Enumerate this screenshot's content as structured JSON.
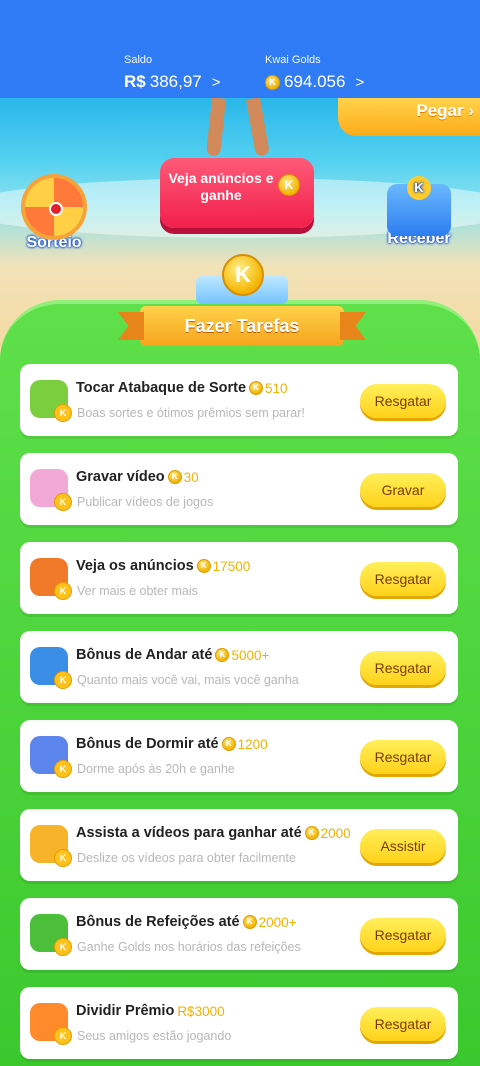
{
  "header": {
    "balance_label": "Saldo",
    "balance_currency": "R$",
    "balance_value": "386,97",
    "golds_label": "Kwai Golds",
    "golds_value": "694.056",
    "chevron": ">"
  },
  "scene": {
    "pegar_label": "Pegar",
    "ads_button_label": "Veja anúncios e ganhe",
    "sorteio_label": "Sorteio",
    "receber_label": "Receber"
  },
  "tasks_banner": "Fazer Tarefas",
  "tasks": [
    {
      "title": "Tocar Atabaque de Sorte",
      "reward": "510",
      "desc": "Boas sortes e ótimos prêmios sem parar!",
      "action": "Resgatar",
      "icon": "drum-icon",
      "icon_color": "#7bcf3f"
    },
    {
      "title": "Gravar vídeo",
      "reward": "30",
      "desc": "Publicar vídeos de jogos",
      "action": "Gravar",
      "icon": "video-record-icon",
      "icon_color": "#f3a9d6"
    },
    {
      "title": "Veja os anúncios",
      "reward": "17500",
      "desc": "Ver mais e obter mais",
      "action": "Resgatar",
      "icon": "tv-icon",
      "icon_color": "#f07a2a"
    },
    {
      "title": "Bônus de Andar até",
      "reward": "5000+",
      "desc": "Quanto mais você vai, mais você ganha",
      "action": "Resgatar",
      "icon": "walking-boy-icon",
      "icon_color": "#3a8ee6"
    },
    {
      "title": "Bônus de Dormir até",
      "reward": "1200",
      "desc": "Dorme após às 20h e ganhe",
      "action": "Resgatar",
      "icon": "sleep-moon-icon",
      "icon_color": "#5b84ec"
    },
    {
      "title": "Assista a vídeos para ganhar até",
      "reward": "2000",
      "desc": "Deslize os vídeos para obter facilmente",
      "action": "Assistir",
      "icon": "camera-icon",
      "icon_color": "#f7b32a"
    },
    {
      "title": "Bônus de Refeições até",
      "reward": "2000+",
      "desc": "Ganhe Golds nos horários das refeições",
      "action": "Resgatar",
      "icon": "calendar-meal-icon",
      "icon_color": "#4cbf3a"
    },
    {
      "title": "Dividir Prêmio",
      "reward": "R$3000",
      "desc": "Seus amigos estão jogando",
      "action": "Resgatar",
      "icon": "gift-box-icon",
      "icon_color": "#ff8a2c"
    }
  ]
}
